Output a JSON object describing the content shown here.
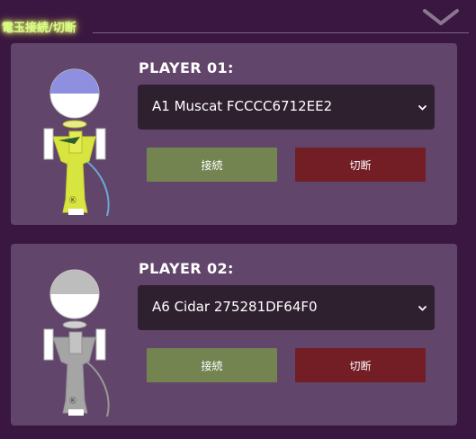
{
  "header": {
    "title": "電玉接続/切断",
    "collapse_icon": "chevron-down-icon"
  },
  "players": [
    {
      "label": "PLAYER 01:",
      "selected_device": "A1 Muscat FCCCC6712EE2",
      "connect_label": "接続",
      "disconnect_label": "切断",
      "kendama_colors": {
        "ball": "#8e90df",
        "body": "#d8e43f",
        "string": "#6aa9d4"
      }
    },
    {
      "label": "PLAYER 02:",
      "selected_device": "A6 Cidar 275281DF64F0",
      "connect_label": "接続",
      "disconnect_label": "切断",
      "kendama_colors": {
        "ball": "#bdbdbd",
        "body": "#a5a5a5",
        "string": "#989898"
      }
    }
  ],
  "colors": {
    "background": "#3a1740",
    "card": "#62456a",
    "select_bg": "#2f2030",
    "connect_button": "#738451",
    "disconnect_button": "#731d25",
    "title_glow": "#d6ff8a"
  }
}
